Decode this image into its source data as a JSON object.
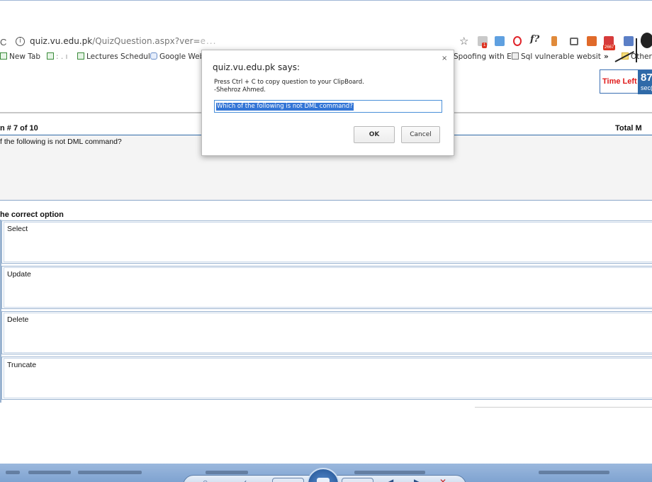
{
  "browser": {
    "reload_glyph": "C",
    "url_host": "quiz.vu.edu.pk",
    "url_path": "/QuizQuestion.aspx?ver=",
    "url_obscured": "e...",
    "star_glyph": "☆",
    "extensions": [
      "ext-badge-icon",
      "pdf-icon",
      "opera-icon",
      "font-icon",
      "tool-icon",
      "camera-icon",
      "bag-icon",
      "mail-icon",
      "fb-icon",
      "account-icon"
    ],
    "badge_count": "1",
    "mail_count": "2667"
  },
  "bookmarks": {
    "items": [
      "New Tab",
      "Lectures Schedule",
      "Google Web",
      "Spoofing with Et",
      "Sql vulnerable websit",
      "Other"
    ],
    "overflow": "»"
  },
  "timer": {
    "label": "Time Left",
    "value": "87",
    "unit": "sec("
  },
  "quiz": {
    "question_header": "n # 7 of 10",
    "total_label": "Total M",
    "question_text": "f the following is not DML command?",
    "choose_label": "he correct option",
    "options": [
      "Select",
      "Update",
      "Delete",
      "Truncate"
    ]
  },
  "dialog": {
    "title": "quiz.vu.edu.pk says:",
    "close": "×",
    "message": "Press Ctrl + C to copy question to your ClipBoard.\n-Shehroz Ahmed.",
    "input_value": "Which of the following is not DML command?",
    "ok_label": "OK",
    "cancel_label": "Cancel"
  },
  "colors": {
    "accent": "#2f6aa8",
    "timer_label": "#e01b1b",
    "selection": "#3375d6"
  }
}
